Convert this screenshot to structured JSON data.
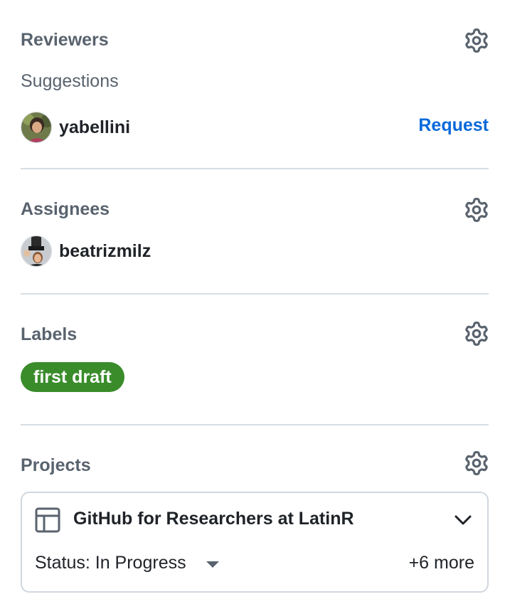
{
  "reviewers": {
    "title": "Reviewers",
    "gear_icon": "gear-icon",
    "suggestions_label": "Suggestions",
    "suggested_user": "yabellini",
    "request_label": "Request"
  },
  "assignees": {
    "title": "Assignees",
    "gear_icon": "gear-icon",
    "user": "beatrizmilz"
  },
  "labels": {
    "title": "Labels",
    "gear_icon": "gear-icon",
    "items": [
      {
        "name": "first draft",
        "color": "#3a8c2b"
      }
    ]
  },
  "projects": {
    "title": "Projects",
    "gear_icon": "gear-icon",
    "card": {
      "icon": "table-icon",
      "name": "GitHub for Researchers at LatinR",
      "status": "Status: In Progress",
      "more": "+6 more"
    }
  },
  "colors": {
    "accent_link": "#0969da",
    "muted_text": "#59636e",
    "divider": "#d8dee4",
    "label_green": "#3a8c2b"
  }
}
